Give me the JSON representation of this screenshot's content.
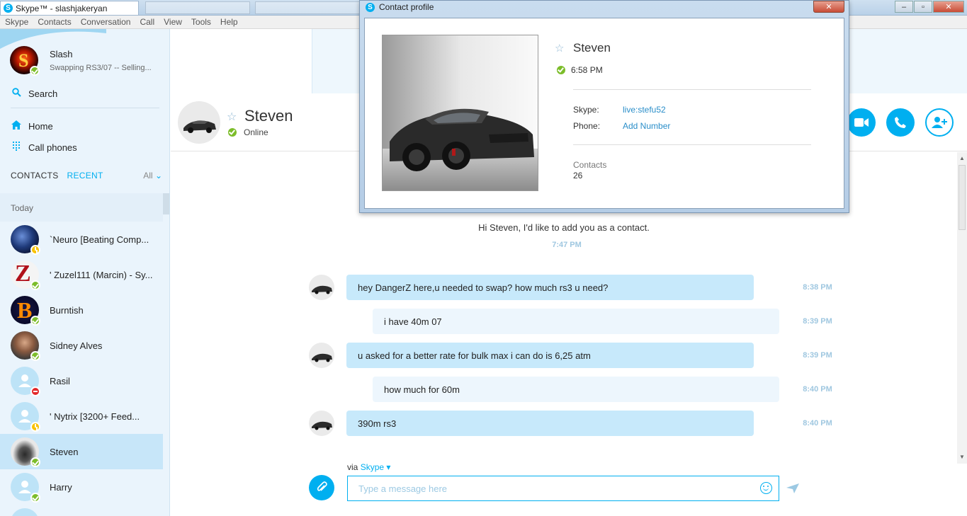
{
  "window": {
    "tab_title": "Skype™ - slashjakeryan",
    "skype_glyph": "S",
    "minimize": "‒",
    "maximize": "▫",
    "close": "✕"
  },
  "menu": [
    "Skype",
    "Contacts",
    "Conversation",
    "Call",
    "View",
    "Tools",
    "Help"
  ],
  "me": {
    "name": "Slash",
    "mood": "Swapping RS3/07 -- Selling..."
  },
  "nav": {
    "search": "Search",
    "home": "Home",
    "call_phones": "Call phones"
  },
  "contact_tabs": {
    "contacts": "CONTACTS",
    "recent": "RECENT",
    "filter": "All"
  },
  "recent": {
    "section": "Today",
    "items": [
      {
        "name": "`Neuro [Beating Comp...",
        "status": "away"
      },
      {
        "name": "' Zuzel111 (Marcin) - Sy...",
        "status": "online"
      },
      {
        "name": "Burntish",
        "status": "online"
      },
      {
        "name": "Sidney Alves",
        "status": "online"
      },
      {
        "name": "Rasil",
        "status": "dnd"
      },
      {
        "name": "'      Nytrix [3200+ Feed...",
        "status": "away"
      },
      {
        "name": "Steven",
        "status": "online"
      },
      {
        "name": "Harry",
        "status": "online"
      }
    ]
  },
  "conversation": {
    "contact_name": "Steven",
    "contact_status": "Online",
    "system_message": "Hi Steven, I'd like to add you as a contact.",
    "system_time": "7:47 PM",
    "messages": [
      {
        "dir": "in",
        "text": "hey DangerZ here,u needed to swap? how much rs3 u need?",
        "time": "8:38 PM"
      },
      {
        "dir": "out",
        "text": "i have 40m 07",
        "time": "8:39 PM"
      },
      {
        "dir": "in",
        "text": "u asked for a better rate for bulk max i can do is 6,25 atm",
        "time": "8:39 PM"
      },
      {
        "dir": "out",
        "text": "how much for 60m",
        "time": "8:40 PM"
      },
      {
        "dir": "in",
        "text": "390m rs3",
        "time": "8:40 PM"
      }
    ],
    "via_prefix": "via",
    "via_service": "Skype",
    "input_placeholder": "Type a message here"
  },
  "profile": {
    "window_title": "Contact profile",
    "name": "Steven",
    "local_time": "6:58 PM",
    "skype_label": "Skype:",
    "skype_value": "live:stefu52",
    "phone_label": "Phone:",
    "phone_value": "Add Number",
    "contacts_label": "Contacts",
    "contacts_count": "26"
  },
  "colors": {
    "accent": "#00aff0",
    "online": "#7cbd2a",
    "away": "#f8c200",
    "dnd": "#e3282a"
  },
  "icons": [
    "skype-icon",
    "search-icon",
    "home-icon",
    "dialpad-icon",
    "chevron-down-icon",
    "star-icon",
    "video-call-icon",
    "phone-call-icon",
    "add-contact-icon",
    "paperclip-icon",
    "emoji-icon",
    "send-icon",
    "close-icon"
  ]
}
